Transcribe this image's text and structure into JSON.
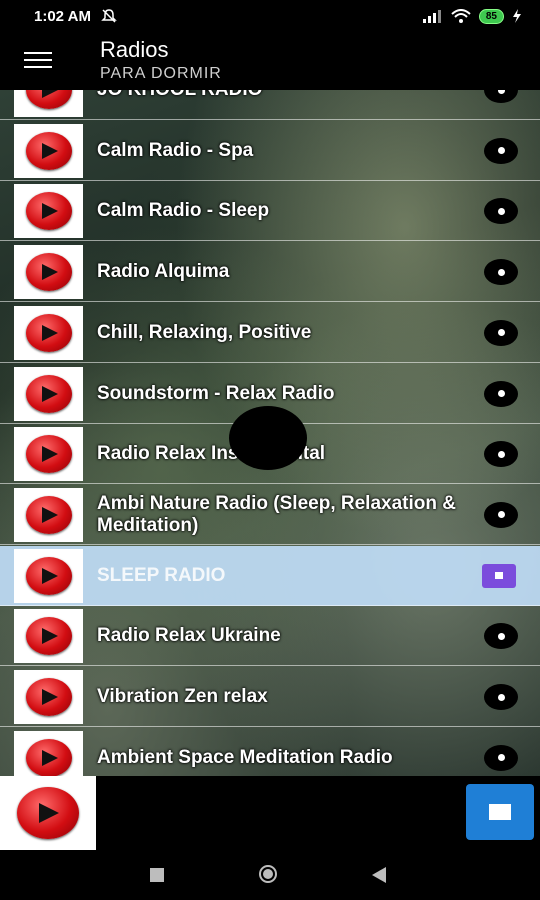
{
  "status_bar": {
    "time": "1:02 AM",
    "battery": "85",
    "icons": [
      "mute-icon",
      "signal-icon",
      "wifi-icon",
      "battery-icon",
      "charging-icon"
    ]
  },
  "toolbar": {
    "title": "Radios",
    "subtitle": "PARA DORMIR",
    "menu_icon": "hamburger-menu-icon"
  },
  "stations": [
    {
      "name": "JO KHOOL RADIO",
      "selected": false
    },
    {
      "name": "Calm Radio - Spa",
      "selected": false
    },
    {
      "name": "Calm Radio - Sleep",
      "selected": false
    },
    {
      "name": "Radio Alquima",
      "selected": false
    },
    {
      "name": "Chill, Relaxing, Positive",
      "selected": false
    },
    {
      "name": "Soundstorm - Relax Radio",
      "selected": false
    },
    {
      "name": "Radio Relax Instrumental",
      "selected": false
    },
    {
      "name": "Ambi Nature Radio (Sleep, Relaxation & Meditation)",
      "selected": false
    },
    {
      "name": "SLEEP RADIO",
      "selected": true
    },
    {
      "name": "Radio Relax Ukraine",
      "selected": false
    },
    {
      "name": "Vibration Zen relax",
      "selected": false
    },
    {
      "name": "Ambient Space Meditation Radio",
      "selected": false
    }
  ],
  "colors": {
    "selected_row": "#bedcf5",
    "stop_small": "#7b4cdc",
    "stop_big": "#1f7fd6",
    "play_red": "#d20d12"
  },
  "player": {
    "thumb_icon": "play-icon",
    "stop_icon": "stop-icon"
  },
  "nav": {
    "icons": [
      "recents-icon",
      "home-icon",
      "back-icon"
    ]
  }
}
